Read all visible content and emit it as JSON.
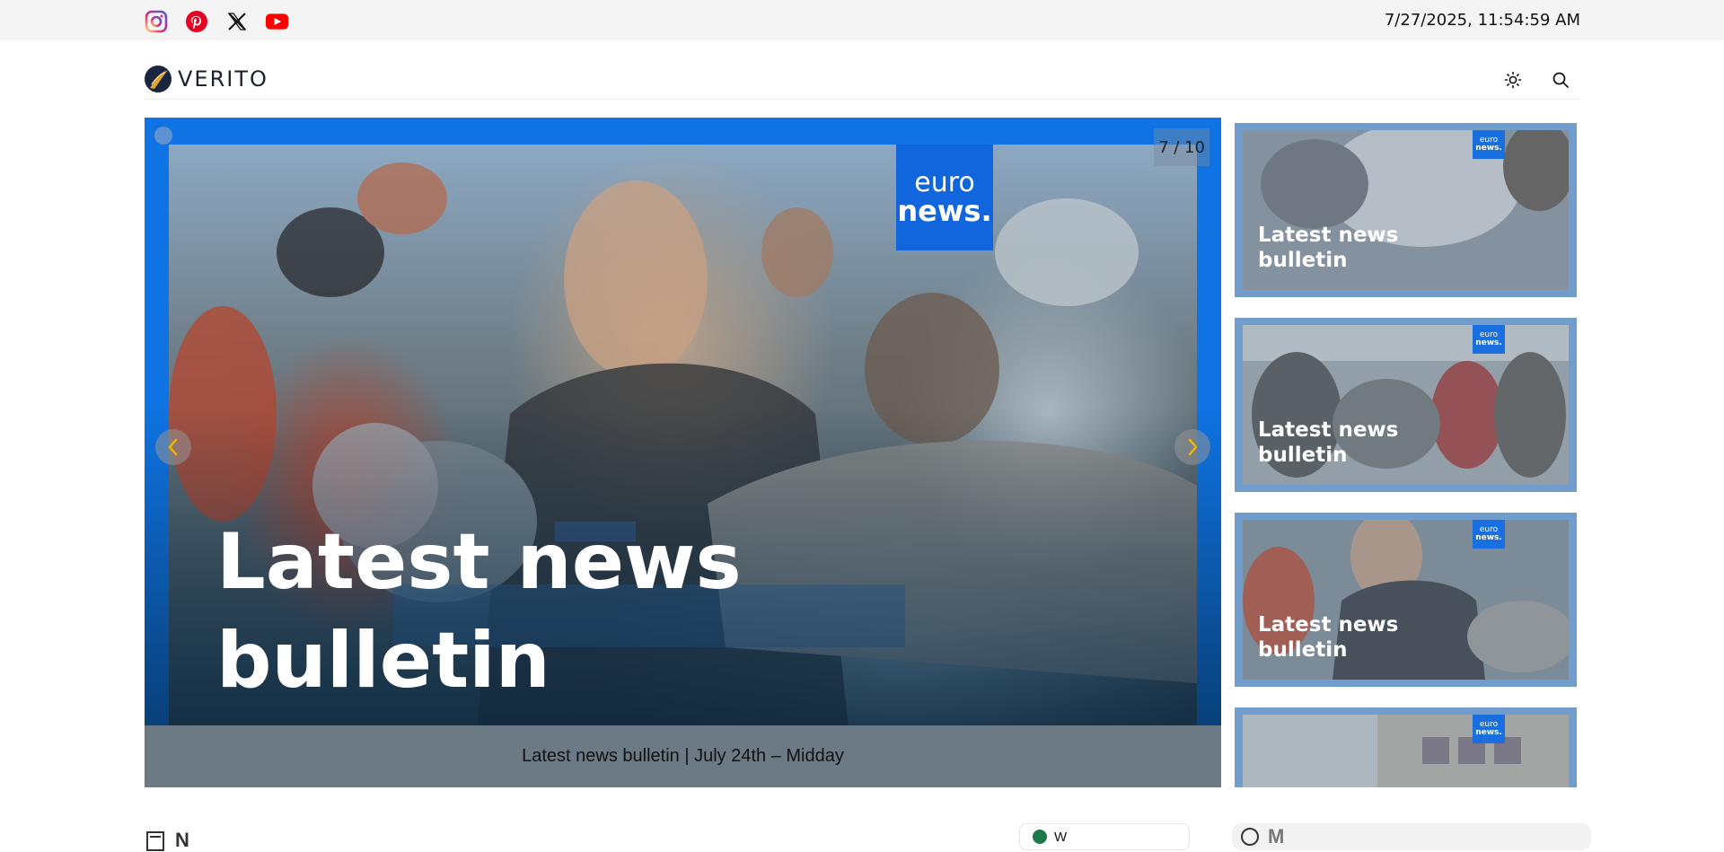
{
  "topbar": {
    "social": [
      {
        "name": "instagram-icon",
        "color": "#d6249f"
      },
      {
        "name": "pinterest-icon",
        "color": "#e60023"
      },
      {
        "name": "x-icon",
        "color": "#111111"
      },
      {
        "name": "youtube-icon",
        "color": "#ff0000"
      }
    ],
    "datetime": "7/27/2025, 11:54:59 AM"
  },
  "header": {
    "logo_text": "VERITO",
    "theme_toggle_icon": "sun-icon",
    "search_icon": "search-icon"
  },
  "slider": {
    "counter": "7 / 10",
    "slide_title": "Latest news bulletin",
    "caption": "Latest news bulletin | July 24th – Midday",
    "badge_top": "euro",
    "badge_bottom": "news.",
    "prev_icon": "chevron-left-icon",
    "next_icon": "chevron-right-icon"
  },
  "side_cards": [
    {
      "title": "Latest news bulletin"
    },
    {
      "title": "Latest news bulletin"
    },
    {
      "title": "Latest news bulletin"
    },
    {
      "title": ""
    }
  ],
  "mini_badge": {
    "top": "euro",
    "bottom": "news."
  },
  "bottom": {
    "news_label": "N",
    "world_label": "W",
    "market_label": "M"
  },
  "colors": {
    "accent_blue": "#0f73e3",
    "arrow_color": "#f5b800",
    "caption_bg": "#6b7a85"
  }
}
